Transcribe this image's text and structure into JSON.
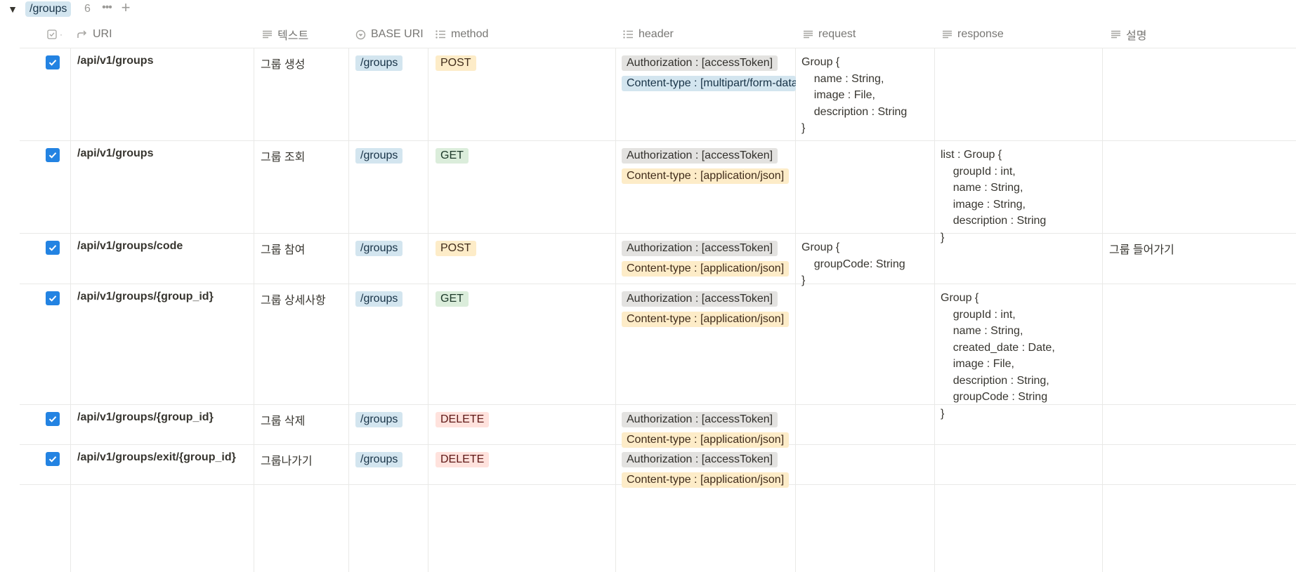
{
  "group": {
    "toggle_icon": "▼",
    "name": "/groups",
    "count": "6",
    "more_icon": "•••",
    "add_icon": "+"
  },
  "columns": {
    "uri": "URI",
    "text": "텍스트",
    "base_uri": "BASE URI",
    "method": "method",
    "header": "header",
    "request": "request",
    "response": "response",
    "desc": "설명"
  },
  "colors": {
    "checkbox": "#2383e2",
    "base_tag": "#d3e5ef",
    "post_tag": "#fdecc8",
    "get_tag": "#dbeddb",
    "delete_tag": "#ffe2dd",
    "auth_tag": "#e3e2e0"
  },
  "rows": [
    {
      "uri": "/api/v1/groups",
      "text": "그룹 생성",
      "base_uri": "/groups",
      "method": "POST",
      "auth": "Authorization : [accessToken]",
      "content_type": "Content-type : [multipart/form-data]",
      "request": "Group {\n    name : String,\n    image : File,\n    description : String\n}",
      "response": "",
      "desc": ""
    },
    {
      "uri": "/api/v1/groups",
      "text": "그룹 조회",
      "base_uri": "/groups",
      "method": "GET",
      "auth": "Authorization : [accessToken]",
      "content_type": "Content-type : [application/json]",
      "request": "",
      "response": "list : Group {\n    groupId : int,\n    name : String,\n    image : String,\n    description : String\n}",
      "desc": ""
    },
    {
      "uri": "/api/v1/groups/code",
      "text": "그룹 참여",
      "base_uri": "/groups",
      "method": "POST",
      "auth": "Authorization : [accessToken]",
      "content_type": "Content-type : [application/json]",
      "request": "Group {\n    groupCode: String\n}",
      "response": "",
      "desc": "그룹 들어가기"
    },
    {
      "uri": "/api/v1/groups/{group_id}",
      "text": "그룹 상세사항",
      "base_uri": "/groups",
      "method": "GET",
      "auth": "Authorization : [accessToken]",
      "content_type": "Content-type : [application/json]",
      "request": "",
      "response": "Group {\n    groupId : int,\n    name : String,\n    created_date : Date,\n    image : File,\n    description : String,\n    groupCode : String\n}",
      "desc": ""
    },
    {
      "uri": "/api/v1/groups/{group_id}",
      "text": "그룹 삭제",
      "base_uri": "/groups",
      "method": "DELETE",
      "auth": "Authorization : [accessToken]",
      "content_type": "Content-type : [application/json]",
      "request": "",
      "response": "",
      "desc": ""
    },
    {
      "uri": "/api/v1/groups/exit/{group_id}",
      "text": "그룹나가기",
      "base_uri": "/groups",
      "method": "DELETE",
      "auth": "Authorization : [accessToken]",
      "content_type": "Content-type : [application/json]",
      "request": "",
      "response": "",
      "desc": ""
    }
  ]
}
